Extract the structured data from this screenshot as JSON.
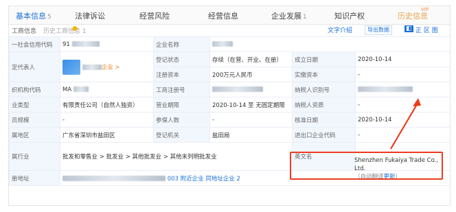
{
  "tabs": [
    {
      "label": "基本信息",
      "count": "5",
      "active": true
    },
    {
      "label": "法律诉讼",
      "count": "",
      "active": false
    },
    {
      "label": "经营风险",
      "count": "",
      "active": false
    },
    {
      "label": "经营信息",
      "count": "",
      "active": false
    },
    {
      "label": "企业发展",
      "count": "1",
      "active": false
    },
    {
      "label": "知识产权",
      "count": "",
      "active": false
    },
    {
      "label": "历史信息",
      "count": "",
      "active": false
    }
  ],
  "vip_badge": "VIP",
  "subheader": {
    "left_label": "工商信息",
    "source_note": "历史工商信息 1",
    "right_link": "文字介绍",
    "export_button": "导出数据",
    "right_icons": "正 区 图"
  },
  "rows": [
    {
      "k1": "一社会信用代码",
      "v1": "91",
      "k2": "企业名称",
      "v2": "",
      "k3": "",
      "v3": ""
    },
    {
      "k1": "定代表人",
      "v1": "企业 >",
      "k2": "登记状态",
      "v2": "存续（在营、开业、在册）",
      "k3": "成立日期",
      "v3": "2020-10-14"
    },
    {
      "k1": "",
      "v1": "",
      "k2": "注册资本",
      "v2": "200万元人民币",
      "k3": "实缴资本",
      "v3": "-"
    },
    {
      "k1": "织机构代码",
      "v1": "MA",
      "k2": "工商注册号",
      "v2": "",
      "k3": "纳税人识别号",
      "v3": ""
    },
    {
      "k1": "业类型",
      "v1": "有限责任公司（自然人独资）",
      "k2": "营业期限",
      "v2": "2020-10-14 至 无固定期限",
      "k3": "纳税人资质",
      "v3": "-"
    },
    {
      "k1": "员规模",
      "v1": "-",
      "k2": "参保人数",
      "v2": "-",
      "k3": "核准日期",
      "v3": "2020-10-14"
    },
    {
      "k1": "属地区",
      "v1": "广东省深圳市盐田区",
      "k2": "登记机关",
      "v2": "盐田局",
      "k3": "进出口企业代码",
      "v3": "-"
    },
    {
      "k1": "属行业",
      "v1": "批发和零售业 > 批发业 > 其他批发业 > 其他未列明批发业",
      "k3": "英文名",
      "v3": ""
    },
    {
      "k1": "册地址",
      "v1": "深圳市盐田区盐田街道...",
      "v1b": "003 附近企业",
      "v1c": "同地址企业 2"
    }
  ],
  "english_name": {
    "value": "Shenzhen Fukaiya Trade Co., Ltd.",
    "note": "（自动翻译",
    "update": "更新",
    "close": "）"
  },
  "colors": {
    "accent": "#1a6fd8",
    "highlight": "#ec3a1e",
    "keycell": "#f2f7fd"
  }
}
